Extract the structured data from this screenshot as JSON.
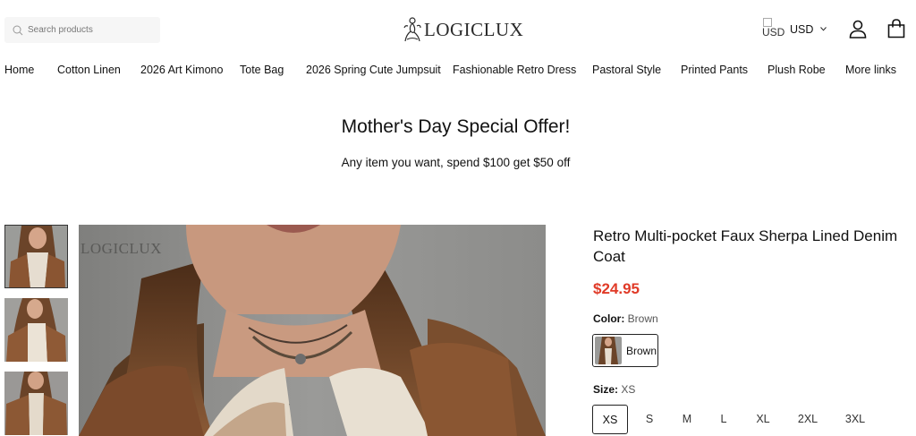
{
  "search": {
    "placeholder": "Search products",
    "icon": "search-icon"
  },
  "brand": {
    "name": "LOGICLUX",
    "icon": "logo-figure-icon"
  },
  "currency": {
    "flag_alt": "USD",
    "label": "USD",
    "icon": "chevron-down-icon"
  },
  "header_icons": {
    "account": "user-icon",
    "cart": "shopping-bag-icon"
  },
  "nav": {
    "items": [
      "Home",
      "Cotton Linen",
      "2026 Art Kimono",
      "Tote Bag",
      "2026 Spring Cute Jumpsuit",
      "Fashionable Retro Dress",
      "Pastoral Style",
      "Printed Pants",
      "Plush Robe",
      "More links"
    ]
  },
  "promo": {
    "title": "Mother's Day Special Offer!",
    "subtitle": "Any item you want, spend $100 get $50 off"
  },
  "gallery": {
    "watermark": "LOGICLUX",
    "thumb_count": 3,
    "selected_thumb": 1
  },
  "product": {
    "title": "Retro Multi-pocket Faux Sherpa Lined Denim Coat",
    "price": "$24.95",
    "color_label": "Color:",
    "color_value": "Brown",
    "color_options": [
      "Brown"
    ],
    "size_label": "Size:",
    "size_value": "XS",
    "sizes": [
      "XS",
      "S",
      "M",
      "L",
      "XL",
      "2XL",
      "3XL"
    ],
    "selected_size": "XS"
  },
  "colors": {
    "accent_price": "#e03a27",
    "text": "#111111",
    "search_bg": "#f6f6f6"
  }
}
